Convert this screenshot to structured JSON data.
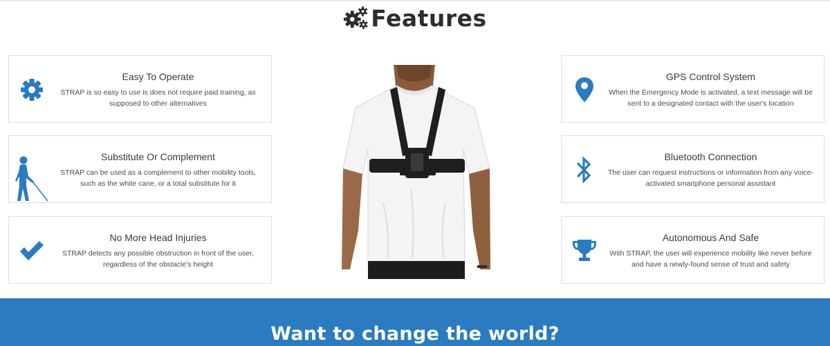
{
  "header": {
    "title": "Features",
    "icon": "gears-icon"
  },
  "features": [
    {
      "title": "Easy To Operate",
      "description": "STRAP is so easy to use is does not require paid training, as supposed to other alternatives",
      "icon": "gear-icon"
    },
    {
      "title": "Substitute Or Complement",
      "description": "STRAP can be used as a complement to other mobility tools, such as the white cane, or a total substitute for it",
      "icon": "blind-person-cane-icon"
    },
    {
      "title": "No More Head Injuries",
      "description": "STRAP detects any possible obstruction in front of the user, regardless of the obstacle's height",
      "icon": "checkmark-icon"
    },
    {
      "title": "GPS Control System",
      "description": "When the Emergency Mode is activated, a text message will be sent to a designated contact with the user's location",
      "icon": "map-marker-icon"
    },
    {
      "title": "Bluetooth Connection",
      "description": "The user can request instructions or information from any voice-activated smartphone personal assistant",
      "icon": "bluetooth-icon"
    },
    {
      "title": "Autonomous And Safe",
      "description": "With STRAP, the user will experience mobility like never before and have a newly-found sense of trust and safety",
      "icon": "trophy-icon"
    }
  ],
  "product_image": {
    "subject": "person wearing chest harness"
  },
  "cta": {
    "title": "Want to change the world?",
    "background": "#2a7bbf"
  },
  "colors": {
    "accent": "#2a7bbf",
    "heading": "#2d2d2d",
    "border": "#dedede"
  }
}
